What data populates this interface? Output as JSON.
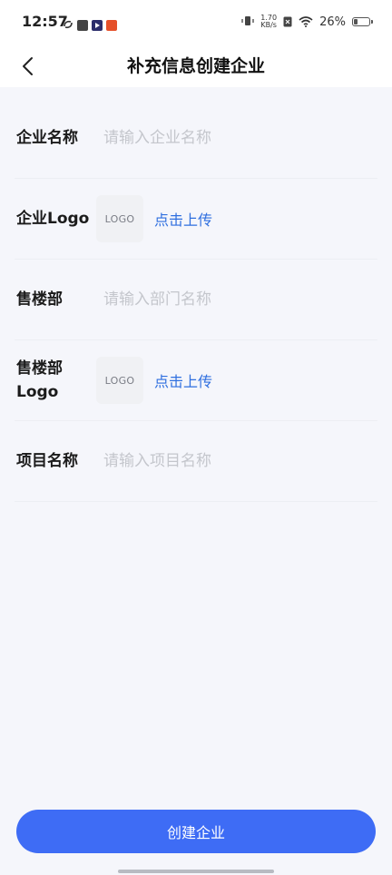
{
  "status_bar": {
    "time": "12:57",
    "net_speed_value": "1.70",
    "net_speed_unit": "KB/s",
    "battery_percent": "26%",
    "battery_level": 0.26
  },
  "nav": {
    "title": "补充信息创建企业"
  },
  "form": {
    "company_name": {
      "label": "企业名称",
      "value": "",
      "placeholder": "请输入企业名称"
    },
    "company_logo": {
      "label": "企业Logo",
      "box_text": "LOGO",
      "upload_label": "点击上传"
    },
    "sales_department": {
      "label": "售楼部",
      "value": "",
      "placeholder": "请输入部门名称"
    },
    "sales_department_logo": {
      "label": "售楼部Logo",
      "box_text": "LOGO",
      "upload_label": "点击上传"
    },
    "project_name": {
      "label": "项目名称",
      "value": "",
      "placeholder": "请输入项目名称"
    }
  },
  "actions": {
    "create_label": "创建企业"
  },
  "colors": {
    "primary": "#3e6cf5",
    "link": "#2f6fdf",
    "placeholder": "#c4c6cc",
    "background": "#f5f6fb"
  },
  "icons": {
    "back": "chevron-left-icon",
    "vibrate": "vibrate-icon",
    "wifi": "wifi-icon",
    "battery": "battery-icon"
  }
}
